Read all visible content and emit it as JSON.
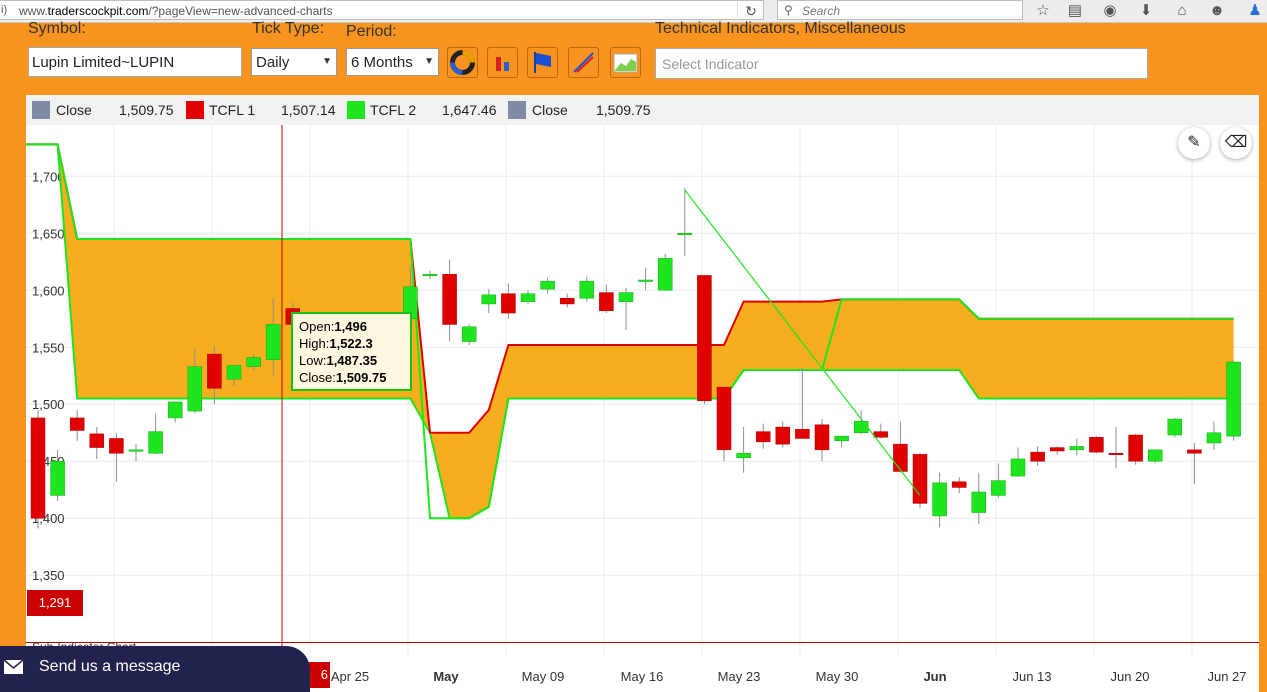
{
  "browser": {
    "url_prefix": "www.",
    "url_domain": "traderscockpit.com",
    "url_path": "/?pageView=new-advanced-charts",
    "search_placeholder": "Search"
  },
  "toolbar": {
    "symbol_label": "Symbol:",
    "symbol_value": "Lupin Limited~LUPIN",
    "tick_type_label": "Tick Type:",
    "tick_type_value": "Daily",
    "period_label": "Period:",
    "period_value": "6 Months",
    "indicators_label": "Technical Indicators, Miscellaneous",
    "indicator_placeholder": "Select Indicator"
  },
  "legend": [
    {
      "name": "Close",
      "value": "1,509.75",
      "color": "#7f8aa4"
    },
    {
      "name": "TCFL 1",
      "value": "1,507.14",
      "color": "#e00000"
    },
    {
      "name": "TCFL 2",
      "value": "1,647.46",
      "color": "#1ee61e"
    },
    {
      "name": "Close",
      "value": "1,509.75",
      "color": "#7f8aa4"
    }
  ],
  "tooltip": {
    "open_label": "Open:",
    "open": "1,496",
    "high_label": "High:",
    "high": "1,522.3",
    "low_label": "Low:",
    "low": "1,487.35",
    "close_label": "Close:",
    "close": "1,509.75"
  },
  "crosshair": {
    "price": "1,291",
    "date_fragment": "6"
  },
  "y_axis_ticks": [
    "1,700",
    "1,650",
    "1,600",
    "1,550",
    "1,500",
    "1,450",
    "1,400",
    "1,350"
  ],
  "x_axis_ticks": [
    "Apr 25",
    "May",
    "May 09",
    "May 16",
    "May 23",
    "May 30",
    "Jun",
    "Jun 13",
    "Jun 20",
    "Jun 27"
  ],
  "below_chart_text": "Sub-Indicator Chart",
  "chat": {
    "label": "Send us a message"
  },
  "colors": {
    "panel": "#f7931e",
    "bull": "#1ee61e",
    "bear": "#e00000",
    "cloud": "#f7ae1e"
  },
  "chart_data": {
    "type": "candlestick",
    "y_range": [
      1280,
      1745
    ],
    "bull_color": "#1ee61e",
    "bear_color": "#e00000",
    "candles": [
      {
        "o": 1488,
        "h": 1495,
        "l": 1391,
        "c": 1400
      },
      {
        "o": 1420,
        "h": 1460,
        "l": 1415,
        "c": 1450
      },
      {
        "o": 1488,
        "h": 1495,
        "l": 1468,
        "c": 1477
      },
      {
        "o": 1474,
        "h": 1480,
        "l": 1452,
        "c": 1462
      },
      {
        "o": 1470,
        "h": 1475,
        "l": 1432,
        "c": 1457
      },
      {
        "o": 1460,
        "h": 1465,
        "l": 1450,
        "c": 1460
      },
      {
        "o": 1457,
        "h": 1492,
        "l": 1456,
        "c": 1476
      },
      {
        "o": 1488,
        "h": 1502,
        "l": 1484,
        "c": 1502
      },
      {
        "o": 1494,
        "h": 1548,
        "l": 1492,
        "c": 1533
      },
      {
        "o": 1544,
        "h": 1551,
        "l": 1500,
        "c": 1514
      },
      {
        "o": 1522,
        "h": 1534,
        "l": 1516,
        "c": 1534
      },
      {
        "o": 1533,
        "h": 1544,
        "l": 1530,
        "c": 1541
      },
      {
        "o": 1539,
        "h": 1593,
        "l": 1525,
        "c": 1570
      },
      {
        "o": 1584,
        "h": 1589,
        "l": 1575,
        "c": 1570
      },
      {
        "o": 1575,
        "h": 1575,
        "l": 1560,
        "c": 1565
      },
      {
        "o": 1560,
        "h": 1565,
        "l": 1540,
        "c": 1540
      },
      {
        "o": 1559,
        "h": 1575,
        "l": 1555,
        "c": 1570
      },
      {
        "o": 1558,
        "h": 1563,
        "l": 1553,
        "c": 1560
      },
      {
        "o": 1560,
        "h": 1570,
        "l": 1555,
        "c": 1565
      },
      {
        "o": 1575,
        "h": 1620,
        "l": 1568,
        "c": 1603
      },
      {
        "o": 1613,
        "h": 1617,
        "l": 1610,
        "c": 1614
      },
      {
        "o": 1614,
        "h": 1627,
        "l": 1555,
        "c": 1570
      },
      {
        "o": 1555,
        "h": 1570,
        "l": 1552,
        "c": 1568
      },
      {
        "o": 1588,
        "h": 1601,
        "l": 1580,
        "c": 1596
      },
      {
        "o": 1597,
        "h": 1606,
        "l": 1575,
        "c": 1580
      },
      {
        "o": 1590,
        "h": 1600,
        "l": 1588,
        "c": 1597
      },
      {
        "o": 1601,
        "h": 1611,
        "l": 1597,
        "c": 1608
      },
      {
        "o": 1593,
        "h": 1597,
        "l": 1585,
        "c": 1588
      },
      {
        "o": 1593,
        "h": 1612,
        "l": 1590,
        "c": 1608
      },
      {
        "o": 1598,
        "h": 1605,
        "l": 1580,
        "c": 1582
      },
      {
        "o": 1590,
        "h": 1602,
        "l": 1565,
        "c": 1598
      },
      {
        "o": 1608,
        "h": 1620,
        "l": 1600,
        "c": 1609
      },
      {
        "o": 1600,
        "h": 1632,
        "l": 1600,
        "c": 1628
      },
      {
        "o": 1650,
        "h": 1690,
        "l": 1630,
        "c": 1650
      },
      {
        "o": 1613,
        "h": 1613,
        "l": 1500,
        "c": 1503
      },
      {
        "o": 1515,
        "h": 1515,
        "l": 1450,
        "c": 1460
      },
      {
        "o": 1453,
        "h": 1480,
        "l": 1440,
        "c": 1457
      },
      {
        "o": 1476,
        "h": 1483,
        "l": 1461,
        "c": 1467
      },
      {
        "o": 1480,
        "h": 1485,
        "l": 1462,
        "c": 1465
      },
      {
        "o": 1478,
        "h": 1532,
        "l": 1470,
        "c": 1470
      },
      {
        "o": 1482,
        "h": 1487,
        "l": 1450,
        "c": 1460
      },
      {
        "o": 1468,
        "h": 1472,
        "l": 1462,
        "c": 1472
      },
      {
        "o": 1475,
        "h": 1495,
        "l": 1474,
        "c": 1485
      },
      {
        "o": 1476,
        "h": 1483,
        "l": 1470,
        "c": 1471
      },
      {
        "o": 1465,
        "h": 1485,
        "l": 1440,
        "c": 1441
      },
      {
        "o": 1456,
        "h": 1457,
        "l": 1409,
        "c": 1413
      },
      {
        "o": 1402,
        "h": 1440,
        "l": 1392,
        "c": 1431
      },
      {
        "o": 1432,
        "h": 1436,
        "l": 1422,
        "c": 1427
      },
      {
        "o": 1405,
        "h": 1440,
        "l": 1395,
        "c": 1423
      },
      {
        "o": 1420,
        "h": 1448,
        "l": 1418,
        "c": 1433
      },
      {
        "o": 1437,
        "h": 1462,
        "l": 1436,
        "c": 1452
      },
      {
        "o": 1458,
        "h": 1463,
        "l": 1446,
        "c": 1450
      },
      {
        "o": 1462,
        "h": 1463,
        "l": 1456,
        "c": 1459
      },
      {
        "o": 1460,
        "h": 1470,
        "l": 1455,
        "c": 1463
      },
      {
        "o": 1471,
        "h": 1472,
        "l": 1457,
        "c": 1458
      },
      {
        "o": 1457,
        "h": 1480,
        "l": 1444,
        "c": 1456
      },
      {
        "o": 1473,
        "h": 1474,
        "l": 1447,
        "c": 1450
      },
      {
        "o": 1450,
        "h": 1460,
        "l": 1448,
        "c": 1460
      },
      {
        "o": 1473,
        "h": 1488,
        "l": 1471,
        "c": 1487
      },
      {
        "o": 1460,
        "h": 1466,
        "l": 1430,
        "c": 1457
      },
      {
        "o": 1466,
        "h": 1485,
        "l": 1460,
        "c": 1475
      },
      {
        "o": 1472,
        "h": 1538,
        "l": 1468,
        "c": 1537
      }
    ],
    "tcfl1": [
      1728,
      1728,
      1645,
      1645,
      1645,
      1645,
      1645,
      1645,
      1645,
      1645,
      1645,
      1645,
      1645,
      1645,
      1645,
      1645,
      1645,
      1645,
      1645,
      1645,
      1475,
      1475,
      1475,
      1495,
      1552,
      1552,
      1552,
      1552,
      1552,
      1552,
      1552,
      1552,
      1552,
      1552,
      1552,
      1552,
      1590,
      1590,
      1590,
      1590,
      1590,
      1592,
      1592,
      1592,
      1592,
      1592,
      1592,
      1592,
      1575,
      1575,
      1575,
      1575,
      1575,
      1575,
      1575,
      1575,
      1575,
      1575,
      1575,
      1575,
      1575,
      1575
    ],
    "tcfl2": [
      1728,
      1728,
      1645,
      1645,
      1645,
      1645,
      1645,
      1645,
      1645,
      1645,
      1645,
      1645,
      1645,
      1645,
      1645,
      1645,
      1645,
      1645,
      1645,
      1645,
      1400,
      1400,
      1400,
      1410,
      1505,
      1505,
      1505,
      1505,
      1505,
      1505,
      1505,
      1505,
      1505,
      1505,
      1505,
      1505,
      1530,
      1530,
      1530,
      1530,
      1530,
      1592,
      1592,
      1592,
      1592,
      1592,
      1592,
      1592,
      1575,
      1575,
      1575,
      1575,
      1575,
      1575,
      1575,
      1575,
      1575,
      1575,
      1575,
      1575,
      1575,
      1575
    ],
    "cloud_lower": [
      1728,
      1728,
      1505,
      1505,
      1505,
      1505,
      1505,
      1505,
      1505,
      1505,
      1505,
      1505,
      1505,
      1505,
      1505,
      1505,
      1505,
      1505,
      1505,
      1505,
      1475,
      1400,
      1400,
      1410,
      1505,
      1505,
      1505,
      1505,
      1505,
      1505,
      1505,
      1505,
      1505,
      1505,
      1505,
      1505,
      1530,
      1530,
      1530,
      1530,
      1530,
      1530,
      1530,
      1530,
      1530,
      1530,
      1530,
      1530,
      1505,
      1505,
      1505,
      1505,
      1505,
      1505,
      1505,
      1505,
      1505,
      1505,
      1505,
      1505,
      1505,
      1505
    ],
    "trendline": [
      [
        33,
        1688
      ],
      [
        45,
        1420
      ]
    ],
    "hline": 1291
  }
}
